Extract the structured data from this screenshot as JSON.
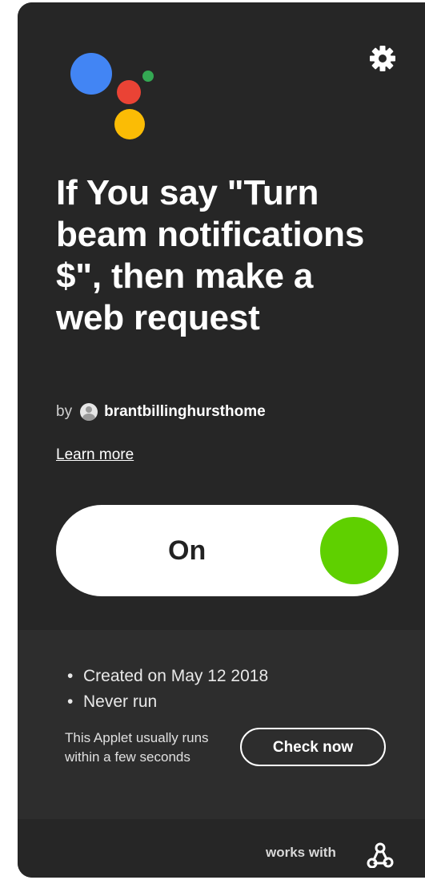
{
  "applet": {
    "title": "If You say \"Turn beam notifications $\", then make a web request",
    "by_label": "by",
    "author": "brantbillinghursthome",
    "learn_more_label": "Learn more"
  },
  "toggle": {
    "label": "On",
    "state": "on",
    "knob_color": "#5fd000"
  },
  "details": {
    "items": [
      "Created on May 12 2018",
      "Never run"
    ],
    "runs_note": "This Applet usually runs within a few seconds",
    "check_button_label": "Check now"
  },
  "footer": {
    "works_with_label": "works with",
    "service_icon": "webhook-icon"
  },
  "icons": {
    "settings": "gear-icon",
    "service_logo": "google-assistant-logo"
  },
  "colors": {
    "card_background": "#262626",
    "details_background": "#2d2d2d",
    "assistant_blue": "#4285f4",
    "assistant_red": "#ea4335",
    "assistant_yellow": "#fbbc05",
    "assistant_green": "#34a853"
  }
}
